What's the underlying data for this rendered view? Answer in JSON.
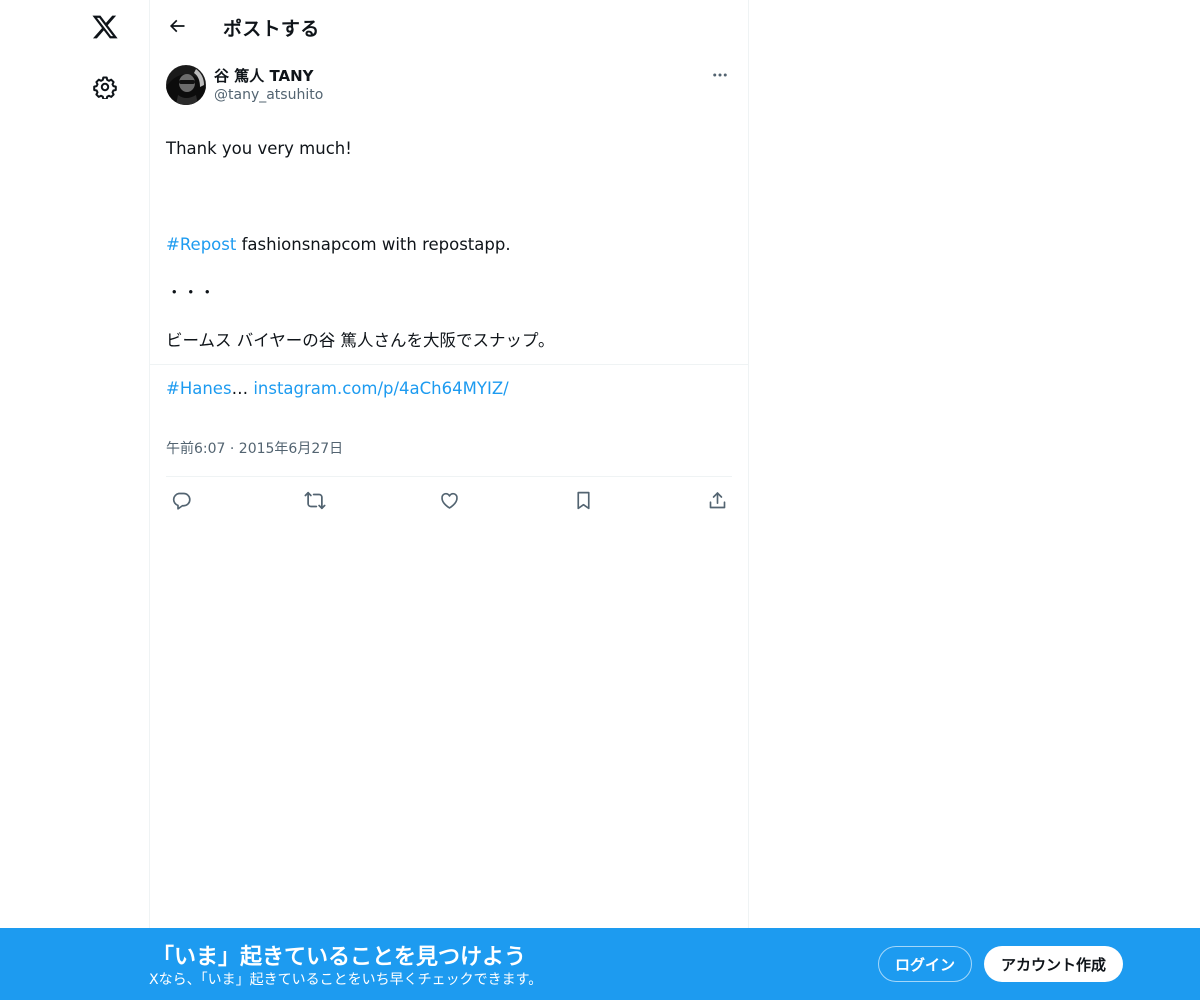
{
  "nav": {
    "logo_icon": "x-logo-icon",
    "settings_icon": "gear-icon"
  },
  "header": {
    "title": "ポストする",
    "back_icon": "arrow-left-icon"
  },
  "post": {
    "author": {
      "name": "谷 篤人 TANY",
      "handle": "@tany_atsuhito"
    },
    "lines": {
      "l1": "Thank you very much!",
      "l2_hashtag": "#Repost",
      "l2_rest": " fashionsnapcom with repostapp.",
      "l3": "・・・",
      "l4": "ビームス バイヤーの谷 篤人さんを大阪でスナップ。",
      "l5_hashtag": "#Hanes",
      "l5_ellipsis": "… ",
      "l5_link": "instagram.com/p/4aCh64MYIZ/"
    },
    "timestamp": "午前6:07 · 2015年6月27日",
    "actions": [
      "reply-icon",
      "repost-icon",
      "like-icon",
      "bookmark-icon",
      "share-icon"
    ]
  },
  "bottom_bar": {
    "title": "「いま」起きていることを見つけよう",
    "subtitle": "Xなら、「いま」起きていることをいち早くチェックできます。",
    "login_label": "ログイン",
    "signup_label": "アカウント作成",
    "background_color": "#1d9bf0"
  },
  "colors": {
    "accent": "#1d9bf0",
    "text": "#0f1419",
    "secondary_text": "#536471"
  }
}
